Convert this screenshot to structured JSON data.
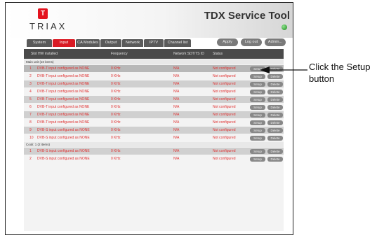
{
  "header": {
    "brand": "TRIAX",
    "logo_mark": "T",
    "title": "TDX Service Tool"
  },
  "tabs": [
    {
      "label": "System"
    },
    {
      "label": "Input"
    },
    {
      "label": "CA Modules"
    },
    {
      "label": "Output"
    },
    {
      "label": "Network"
    },
    {
      "label": "IPTV"
    },
    {
      "label": "Channel list"
    }
  ],
  "actions": {
    "apply": "Apply",
    "logout": "Log out",
    "admin": "Admin..."
  },
  "table": {
    "columns": {
      "slot": "Slot HW installed",
      "frequency": "Frequency",
      "network": "Network SDT/TS ID",
      "status": "Status"
    },
    "groups": [
      {
        "label": "Main unit (10 items)",
        "rows": [
          {
            "slot": "1",
            "desc": "DVB-T input configured as NONE",
            "freq": "0 KHz",
            "net": "N/A",
            "status": "Not configured"
          },
          {
            "slot": "2",
            "desc": "DVB-T input configured as NONE",
            "freq": "0 KHz",
            "net": "N/A",
            "status": "Not configured"
          },
          {
            "slot": "3",
            "desc": "DVB-T input configured as NONE",
            "freq": "0 KHz",
            "net": "N/A",
            "status": "Not configured"
          },
          {
            "slot": "4",
            "desc": "DVB-T input configured as NONE",
            "freq": "0 KHz",
            "net": "N/A",
            "status": "Not configured"
          },
          {
            "slot": "5",
            "desc": "DVB-T input configured as NONE",
            "freq": "0 KHz",
            "net": "N/A",
            "status": "Not configured"
          },
          {
            "slot": "6",
            "desc": "DVB-T input configured as NONE",
            "freq": "0 KHz",
            "net": "N/A",
            "status": "Not configured"
          },
          {
            "slot": "7",
            "desc": "DVB-T input configured as NONE",
            "freq": "0 KHz",
            "net": "N/A",
            "status": "Not configured"
          },
          {
            "slot": "8",
            "desc": "DVB-T input configured as NONE",
            "freq": "0 KHz",
            "net": "N/A",
            "status": "Not configured"
          },
          {
            "slot": "9",
            "desc": "DVB-S input configured as NONE",
            "freq": "0 KHz",
            "net": "N/A",
            "status": "Not configured"
          },
          {
            "slot": "10",
            "desc": "DVB-S input configured as NONE",
            "freq": "0 KHz",
            "net": "N/A",
            "status": "Not configured"
          }
        ]
      },
      {
        "label": "Cooli: 1 (2 items)",
        "rows": [
          {
            "slot": "1",
            "desc": "DVB-S input configured as NONE",
            "freq": "0 KHz",
            "net": "N/A",
            "status": "Not configured"
          },
          {
            "slot": "2",
            "desc": "DVB-S input configured as NONE",
            "freq": "0 KHz",
            "net": "N/A",
            "status": "Not configured"
          }
        ]
      }
    ],
    "setup_label": "Setup",
    "delete_label": "Delete"
  },
  "annotation": {
    "line1": "Click the Setup",
    "line2": "button"
  },
  "colors": {
    "brand_red": "#e4131e",
    "row_text": "#e03030",
    "header_bar": "#4a4a4a",
    "status_led": "#1b8a1b"
  }
}
